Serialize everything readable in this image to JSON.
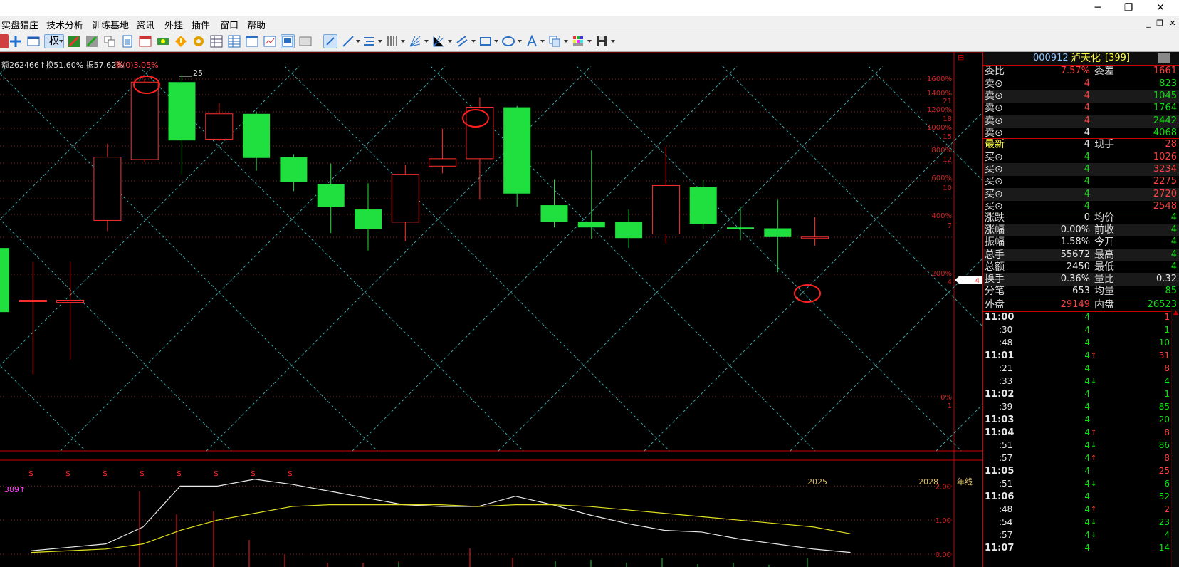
{
  "window": {
    "minimize_glyph": "─",
    "restore_glyph": "❐",
    "close_glyph": "✕",
    "mdi_min": "_",
    "mdi_restore": "❐",
    "mdi_close": "✕"
  },
  "menu": [
    "实盘猎庄",
    "技术分析",
    "训练基地",
    "资讯",
    "外挂",
    "插件",
    "窗口",
    "帮助"
  ],
  "toolbar": {
    "quan_label": "权"
  },
  "chart_header": {
    "prefix": "额262466↑换51.60% 振57.62%",
    "zhang": "涨(0)3.05%",
    "peak_label": "25"
  },
  "price_axis": [
    {
      "text": "1600%",
      "pct": 1600
    },
    {
      "text": "1400%",
      "pct": 1400
    },
    {
      "text": "21",
      "pct": 1300
    },
    {
      "text": "1200%",
      "pct": 1200
    },
    {
      "text": "18",
      "pct": 1100
    },
    {
      "text": "1000%",
      "pct": 1000
    },
    {
      "text": "15",
      "pct": 900
    },
    {
      "text": "800%",
      "pct": 800
    },
    {
      "text": "12",
      "pct": 700
    },
    {
      "text": "600%",
      "pct": 600
    },
    {
      "text": "10",
      "pct": 500
    },
    {
      "text": "400%",
      "pct": 400
    },
    {
      "text": "7",
      "pct": 300
    },
    {
      "text": "200%",
      "pct": 200
    },
    {
      "text": "4",
      "pct": 150
    },
    {
      "text": "0%",
      "pct": 0
    },
    {
      "text": "1",
      "pct": -30
    }
  ],
  "current_price_tag": "4",
  "time_axis": [
    {
      "text": "2025"
    },
    {
      "text": "2028"
    },
    {
      "text": "年线"
    }
  ],
  "dividend_marker": "$",
  "indicator": {
    "label": "389↑",
    "axis": [
      "2.00",
      "1.00",
      "0.00"
    ]
  },
  "chart_data": {
    "type": "candlestick",
    "candles": [
      {
        "open": 3.5,
        "close": 1.6,
        "high": 3.6,
        "low": 1.5
      },
      {
        "open": 1.85,
        "close": 1.85,
        "high": 2.95,
        "low": 0.75
      },
      {
        "open": 1.8,
        "close": 1.85,
        "high": 2.95,
        "low": 0.9
      },
      {
        "open": 4.9,
        "close": 10.6,
        "high": 12.5,
        "low": 4.3
      },
      {
        "open": 10.3,
        "close": 26.5,
        "high": 27.5,
        "low": 10.0
      },
      {
        "open": 26.5,
        "close": 13.0,
        "high": 29.0,
        "low": 8.6
      },
      {
        "open": 13.2,
        "close": 18.0,
        "high": 20.5,
        "low": 12.9
      },
      {
        "open": 18.0,
        "close": 10.5,
        "high": 18.5,
        "low": 9.0
      },
      {
        "open": 10.6,
        "close": 7.8,
        "high": 11.0,
        "low": 7.0
      },
      {
        "open": 7.6,
        "close": 5.8,
        "high": 9.8,
        "low": 4.2
      },
      {
        "open": 5.6,
        "close": 4.4,
        "high": 7.7,
        "low": 3.4
      },
      {
        "open": 4.8,
        "close": 8.6,
        "high": 9.6,
        "low": 3.8
      },
      {
        "open": 9.5,
        "close": 10.4,
        "high": 15.0,
        "low": 8.7
      },
      {
        "open": 10.4,
        "close": 19.5,
        "high": 22.0,
        "low": 6.3
      },
      {
        "open": 19.5,
        "close": 6.8,
        "high": 19.8,
        "low": 5.8
      },
      {
        "open": 5.9,
        "close": 4.8,
        "high": 8.1,
        "low": 4.5
      },
      {
        "open": 4.8,
        "close": 4.5,
        "high": 11.5,
        "low": 3.9
      },
      {
        "open": 4.8,
        "close": 3.95,
        "high": 5.6,
        "low": 3.5
      },
      {
        "open": 4.15,
        "close": 7.5,
        "high": 12.0,
        "low": 3.7
      },
      {
        "open": 7.4,
        "close": 4.7,
        "high": 8.0,
        "low": 4.4
      },
      {
        "open": 4.5,
        "close": 4.45,
        "high": 5.8,
        "low": 3.85
      },
      {
        "open": 4.45,
        "close": 4.0,
        "high": 6.3,
        "low": 2.6
      },
      {
        "open": 4.0,
        "close": 4.0,
        "high": 5.1,
        "low": 3.6
      }
    ],
    "indicator_white": [
      0.1,
      0.2,
      0.3,
      0.8,
      2.0,
      2.0,
      2.2,
      2.05,
      1.85,
      1.65,
      1.45,
      1.4,
      1.4,
      1.7,
      1.45,
      1.15,
      0.9,
      0.7,
      0.65,
      0.45,
      0.3,
      0.15,
      0.05
    ],
    "indicator_yellow": [
      0.05,
      0.1,
      0.15,
      0.3,
      0.7,
      1.0,
      1.2,
      1.4,
      1.45,
      1.45,
      1.45,
      1.45,
      1.4,
      1.45,
      1.45,
      1.4,
      1.3,
      1.2,
      1.1,
      1.0,
      0.9,
      0.8,
      0.6
    ]
  },
  "quote": {
    "code": "000912",
    "name": "泸天化",
    "count": "[399]",
    "weibi_label": "委比",
    "weibi_value": "7.57%",
    "weicha_label": "委差",
    "weicha_value": "1661",
    "sells": [
      {
        "label": "卖⊙",
        "price": "4",
        "vol": "823"
      },
      {
        "label": "卖⊙",
        "price": "4",
        "vol": "1045"
      },
      {
        "label": "卖⊙",
        "price": "4",
        "vol": "1764"
      },
      {
        "label": "卖⊙",
        "price": "4",
        "vol": "2442"
      },
      {
        "label": "卖⊙",
        "price": "4",
        "vol": "4068"
      }
    ],
    "latest_label": "最新",
    "latest_value": "4",
    "xianshou_label": "现手",
    "xianshou_value": "28",
    "buys": [
      {
        "label": "买⊙",
        "price": "4",
        "vol": "1026"
      },
      {
        "label": "买⊙",
        "price": "4",
        "vol": "3234"
      },
      {
        "label": "买⊙",
        "price": "4",
        "vol": "2275"
      },
      {
        "label": "买⊙",
        "price": "4",
        "vol": "2720"
      },
      {
        "label": "买⊙",
        "price": "4",
        "vol": "2548"
      }
    ],
    "stats": [
      {
        "l1": "涨跌",
        "v1": "0",
        "l2": "均价",
        "v2": "4"
      },
      {
        "l1": "涨幅",
        "v1": "0.00%",
        "l2": "前收",
        "v2": "4"
      },
      {
        "l1": "振幅",
        "v1": "1.58%",
        "l2": "今开",
        "v2": "4"
      },
      {
        "l1": "总手",
        "v1": "55672",
        "l2": "最高",
        "v2": "4"
      },
      {
        "l1": "总额",
        "v1": "2450",
        "l2": "最低",
        "v2": "4"
      },
      {
        "l1": "换手",
        "v1": "0.36%",
        "l2": "量比",
        "v2": "0.32"
      },
      {
        "l1": "分笔",
        "v1": "653",
        "l2": "均量",
        "v2": "85"
      }
    ],
    "waipan_label": "外盘",
    "waipan_value": "29149",
    "neipan_label": "内盘",
    "neipan_value": "26523",
    "ticks": [
      {
        "time": "11:00",
        "price": "4",
        "arrow": "",
        "vol": "1",
        "vc": "red"
      },
      {
        "time": ":30",
        "price": "4",
        "arrow": "",
        "vol": "1",
        "vc": "grn"
      },
      {
        "time": ":48",
        "price": "4",
        "arrow": "",
        "vol": "10",
        "vc": "grn"
      },
      {
        "time": "11:01",
        "price": "4",
        "arrow": "↑",
        "vol": "31",
        "vc": "red"
      },
      {
        "time": ":21",
        "price": "4",
        "arrow": "",
        "vol": "8",
        "vc": "red"
      },
      {
        "time": ":33",
        "price": "4",
        "arrow": "↓",
        "vol": "4",
        "vc": "grn"
      },
      {
        "time": "11:02",
        "price": "4",
        "arrow": "",
        "vol": "1",
        "vc": "grn"
      },
      {
        "time": ":39",
        "price": "4",
        "arrow": "",
        "vol": "85",
        "vc": "grn"
      },
      {
        "time": "11:03",
        "price": "4",
        "arrow": "",
        "vol": "20",
        "vc": "grn"
      },
      {
        "time": "11:04",
        "price": "4",
        "arrow": "↑",
        "vol": "8",
        "vc": "red"
      },
      {
        "time": ":51",
        "price": "4",
        "arrow": "↓",
        "vol": "86",
        "vc": "grn"
      },
      {
        "time": ":57",
        "price": "4",
        "arrow": "↑",
        "vol": "8",
        "vc": "red"
      },
      {
        "time": "11:05",
        "price": "4",
        "arrow": "",
        "vol": "25",
        "vc": "red"
      },
      {
        "time": ":51",
        "price": "4",
        "arrow": "↓",
        "vol": "6",
        "vc": "grn"
      },
      {
        "time": "11:06",
        "price": "4",
        "arrow": "",
        "vol": "52",
        "vc": "grn"
      },
      {
        "time": ":48",
        "price": "4",
        "arrow": "↑",
        "vol": "2",
        "vc": "red"
      },
      {
        "time": ":54",
        "price": "4",
        "arrow": "↓",
        "vol": "23",
        "vc": "grn"
      },
      {
        "time": ":57",
        "price": "4",
        "arrow": "↓",
        "vol": "4",
        "vc": "grn"
      },
      {
        "time": "11:07",
        "price": "4",
        "arrow": "",
        "vol": "14",
        "vc": "grn"
      }
    ]
  }
}
